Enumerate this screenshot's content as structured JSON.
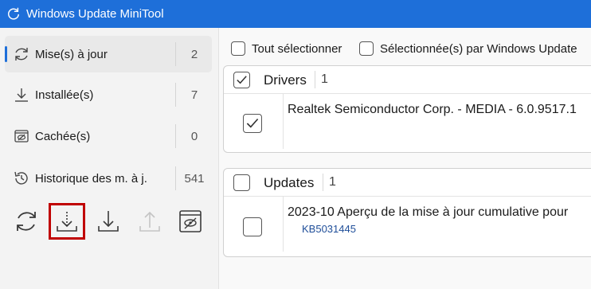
{
  "window": {
    "title": "Windows Update MiniTool"
  },
  "sidebar": {
    "items": [
      {
        "label": "Mise(s) à jour",
        "count": "2",
        "icon": "refresh-icon"
      },
      {
        "label": "Installée(s)",
        "count": "7",
        "icon": "download-icon"
      },
      {
        "label": "Cachée(s)",
        "count": "0",
        "icon": "hidden-icon"
      },
      {
        "label": "Historique des m. à j.",
        "count": "541",
        "icon": "history-icon"
      }
    ],
    "toolbar": [
      "refresh-icon",
      "download-icon",
      "install-icon",
      "upload-icon",
      "hide-icon"
    ]
  },
  "main": {
    "select_all_label": "Tout sélectionner",
    "select_wu_label": "Sélectionnée(s) par Windows Update",
    "groups": [
      {
        "title": "Drivers",
        "count": "1",
        "checked": true,
        "items": [
          {
            "text": "Realtek Semiconductor Corp. - MEDIA - 6.0.9517.1",
            "kb": "",
            "checked": true
          }
        ]
      },
      {
        "title": "Updates",
        "count": "1",
        "checked": false,
        "items": [
          {
            "text": "2023-10 Aperçu de la mise à jour cumulative pour",
            "kb": "KB5031445",
            "checked": false
          }
        ]
      }
    ]
  },
  "colors": {
    "accent": "#1e6fd9",
    "highlight": "#c00000",
    "link": "#1f4e99"
  }
}
